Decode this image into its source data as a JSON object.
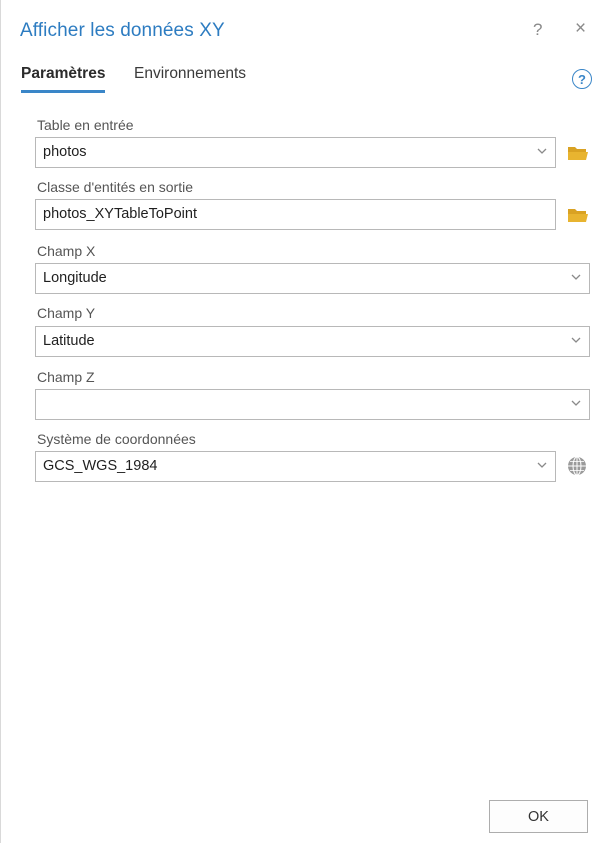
{
  "window": {
    "title": "Afficher les données XY",
    "help_glyph": "?",
    "close_glyph": "×"
  },
  "tabs": [
    {
      "label": "Paramètres",
      "active": true
    },
    {
      "label": "Environnements",
      "active": false
    }
  ],
  "help_circle_glyph": "?",
  "fields": {
    "table_input": {
      "label": "Table en entrée",
      "value": "photos",
      "icon": "folder-open-icon"
    },
    "output_class": {
      "label": "Classe d'entités en sortie",
      "value": "photos_XYTableToPoint",
      "icon": "folder-open-icon"
    },
    "champ_x": {
      "label": "Champ X",
      "value": "Longitude"
    },
    "champ_y": {
      "label": "Champ Y",
      "value": "Latitude"
    },
    "champ_z": {
      "label": "Champ Z",
      "value": ""
    },
    "coord_system": {
      "label": "Système de coordonnées",
      "value": "GCS_WGS_1984",
      "icon": "globe-icon"
    }
  },
  "ok_label": "OK",
  "colors": {
    "title": "#2d7cc1",
    "accent": "#3a86c8",
    "folder": "#e8b430",
    "border": "#b8b8b8"
  }
}
